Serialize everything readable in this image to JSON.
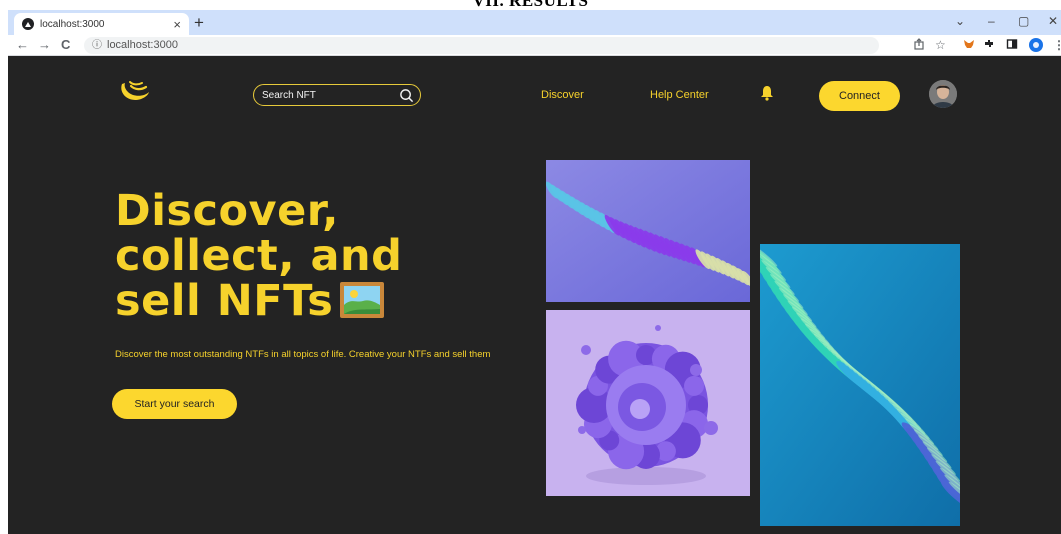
{
  "document": {
    "heading": "VII. RESULTS"
  },
  "browser": {
    "tab_title": "localhost:3000",
    "tab_close": "×",
    "new_tab": "+",
    "url": "localhost:3000",
    "window_controls": {
      "dropdown": "⌄",
      "minimize": "–",
      "restore": "▢",
      "close": "✕"
    },
    "toolbar_icons": [
      "share-icon",
      "star-icon",
      "metamask-icon",
      "extensions-icon",
      "side-panel-icon",
      "profile-icon",
      "menu-icon"
    ]
  },
  "site": {
    "search": {
      "placeholder": "Search NFT"
    },
    "nav": {
      "discover": "Discover",
      "help_center": "Help Center"
    },
    "connect_label": "Connect",
    "hero": {
      "line1": "Discover,",
      "line2": "collect, and",
      "line3": "sell NFTs",
      "subtitle": "Discover the most outstanding NTFs in all topics of life. Creative your NTFs and sell them",
      "cta": "Start your search"
    },
    "colors": {
      "accent": "#fcd72e",
      "background": "#232323",
      "text_accent": "#f6d22c"
    }
  }
}
